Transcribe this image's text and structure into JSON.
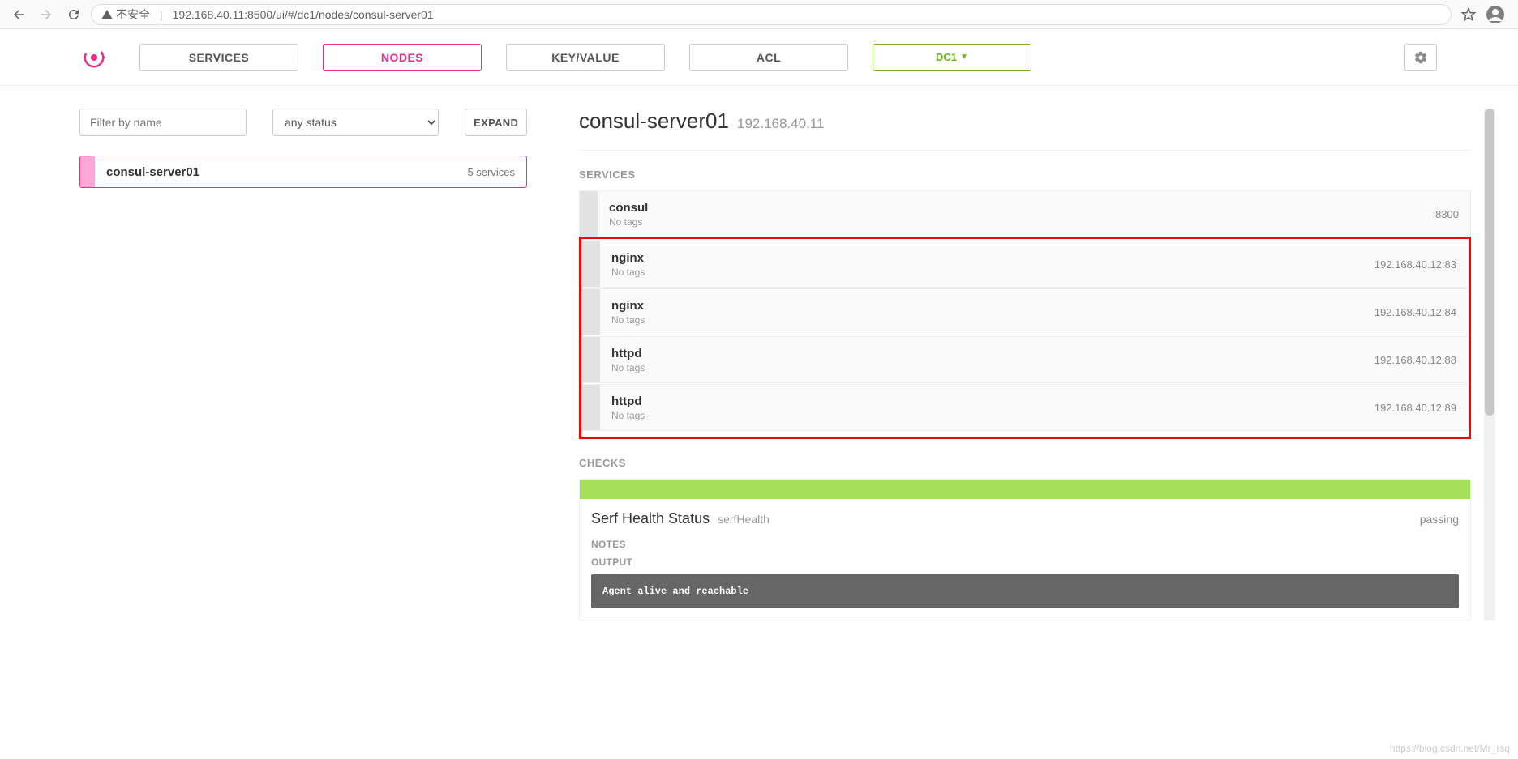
{
  "browser": {
    "insecure_label": "不安全",
    "url": "192.168.40.11:8500/ui/#/dc1/nodes/consul-server01"
  },
  "nav": {
    "services": "SERVICES",
    "nodes": "NODES",
    "kv": "KEY/VALUE",
    "acl": "ACL",
    "dc": "DC1"
  },
  "left": {
    "filter_placeholder": "Filter by name",
    "status_option": "any status",
    "expand": "EXPAND",
    "node": {
      "name": "consul-server01",
      "services_count": "5 services"
    }
  },
  "detail": {
    "title": "consul-server01",
    "ip": "192.168.40.11",
    "services_label": "SERVICES",
    "checks_label": "CHECKS",
    "notes_label": "NOTES",
    "output_label": "OUTPUT",
    "services": [
      {
        "name": "consul",
        "tags": "No tags",
        "addr": ":8300"
      },
      {
        "name": "nginx",
        "tags": "No tags",
        "addr": "192.168.40.12:83"
      },
      {
        "name": "nginx",
        "tags": "No tags",
        "addr": "192.168.40.12:84"
      },
      {
        "name": "httpd",
        "tags": "No tags",
        "addr": "192.168.40.12:88"
      },
      {
        "name": "httpd",
        "tags": "No tags",
        "addr": "192.168.40.12:89"
      }
    ],
    "check": {
      "title": "Serf Health Status",
      "id": "serfHealth",
      "status": "passing",
      "output": "Agent alive and reachable"
    }
  },
  "watermark": "https://blog.csdn.net/Mr_rsq"
}
